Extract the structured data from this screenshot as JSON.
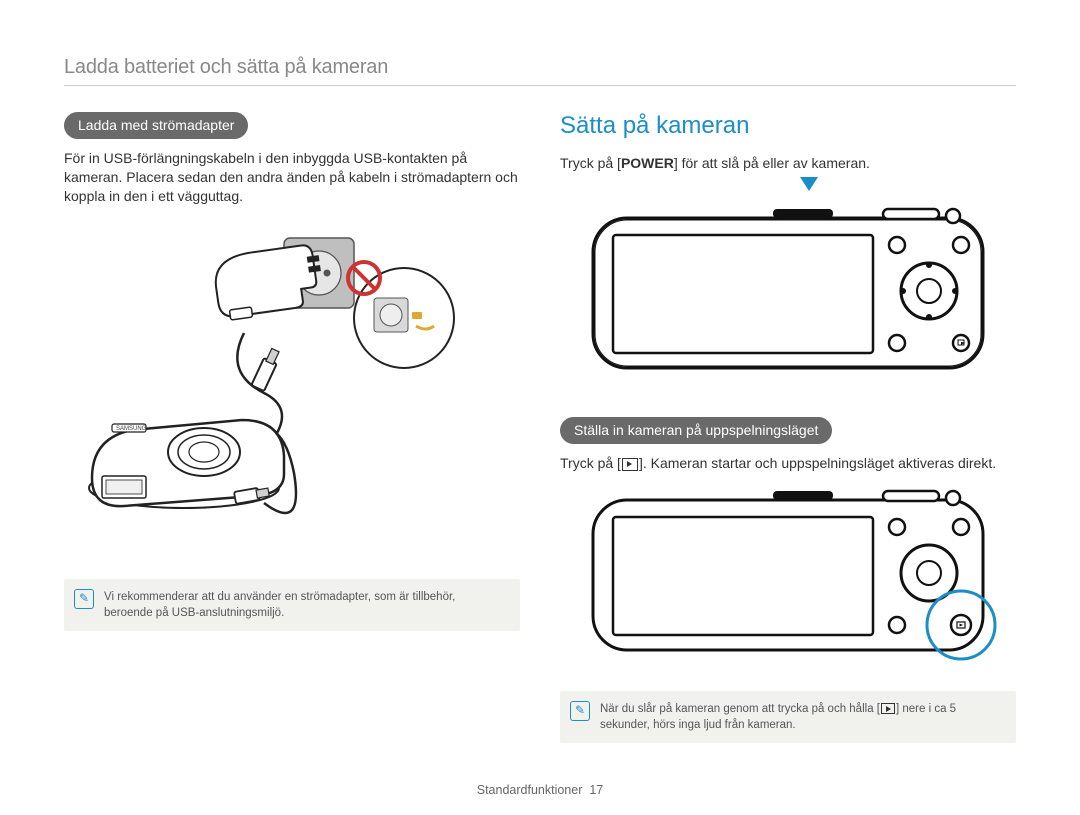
{
  "header": "Ladda batteriet och sätta på kameran",
  "left": {
    "pill": "Ladda med strömadapter",
    "body": "För in USB-förlängningskabeln i den inbyggda USB-kontakten på kameran. Placera sedan den andra änden på kabeln i strömadaptern och koppla in den i ett vägguttag.",
    "note": "Vi rekommenderar att du använder en strömadapter, som är tillbehör, beroende på USB-anslutningsmiljö."
  },
  "right": {
    "title": "Sätta på kameran",
    "power_pre": "Tryck på [",
    "power_strong": "POWER",
    "power_post": "] för att slå på eller av kameran.",
    "pill2": "Ställa in kameran på uppspelningsläget",
    "play_pre": "Tryck på [",
    "play_post": "]. Kameran startar och uppspelningsläget aktiveras direkt.",
    "note_pre": "När du slår på kameran genom att trycka på och hålla [",
    "note_post": "] nere i ca 5 sekunder, hörs inga ljud från kameran."
  },
  "footer": {
    "section": "Standardfunktioner",
    "page": "17"
  }
}
